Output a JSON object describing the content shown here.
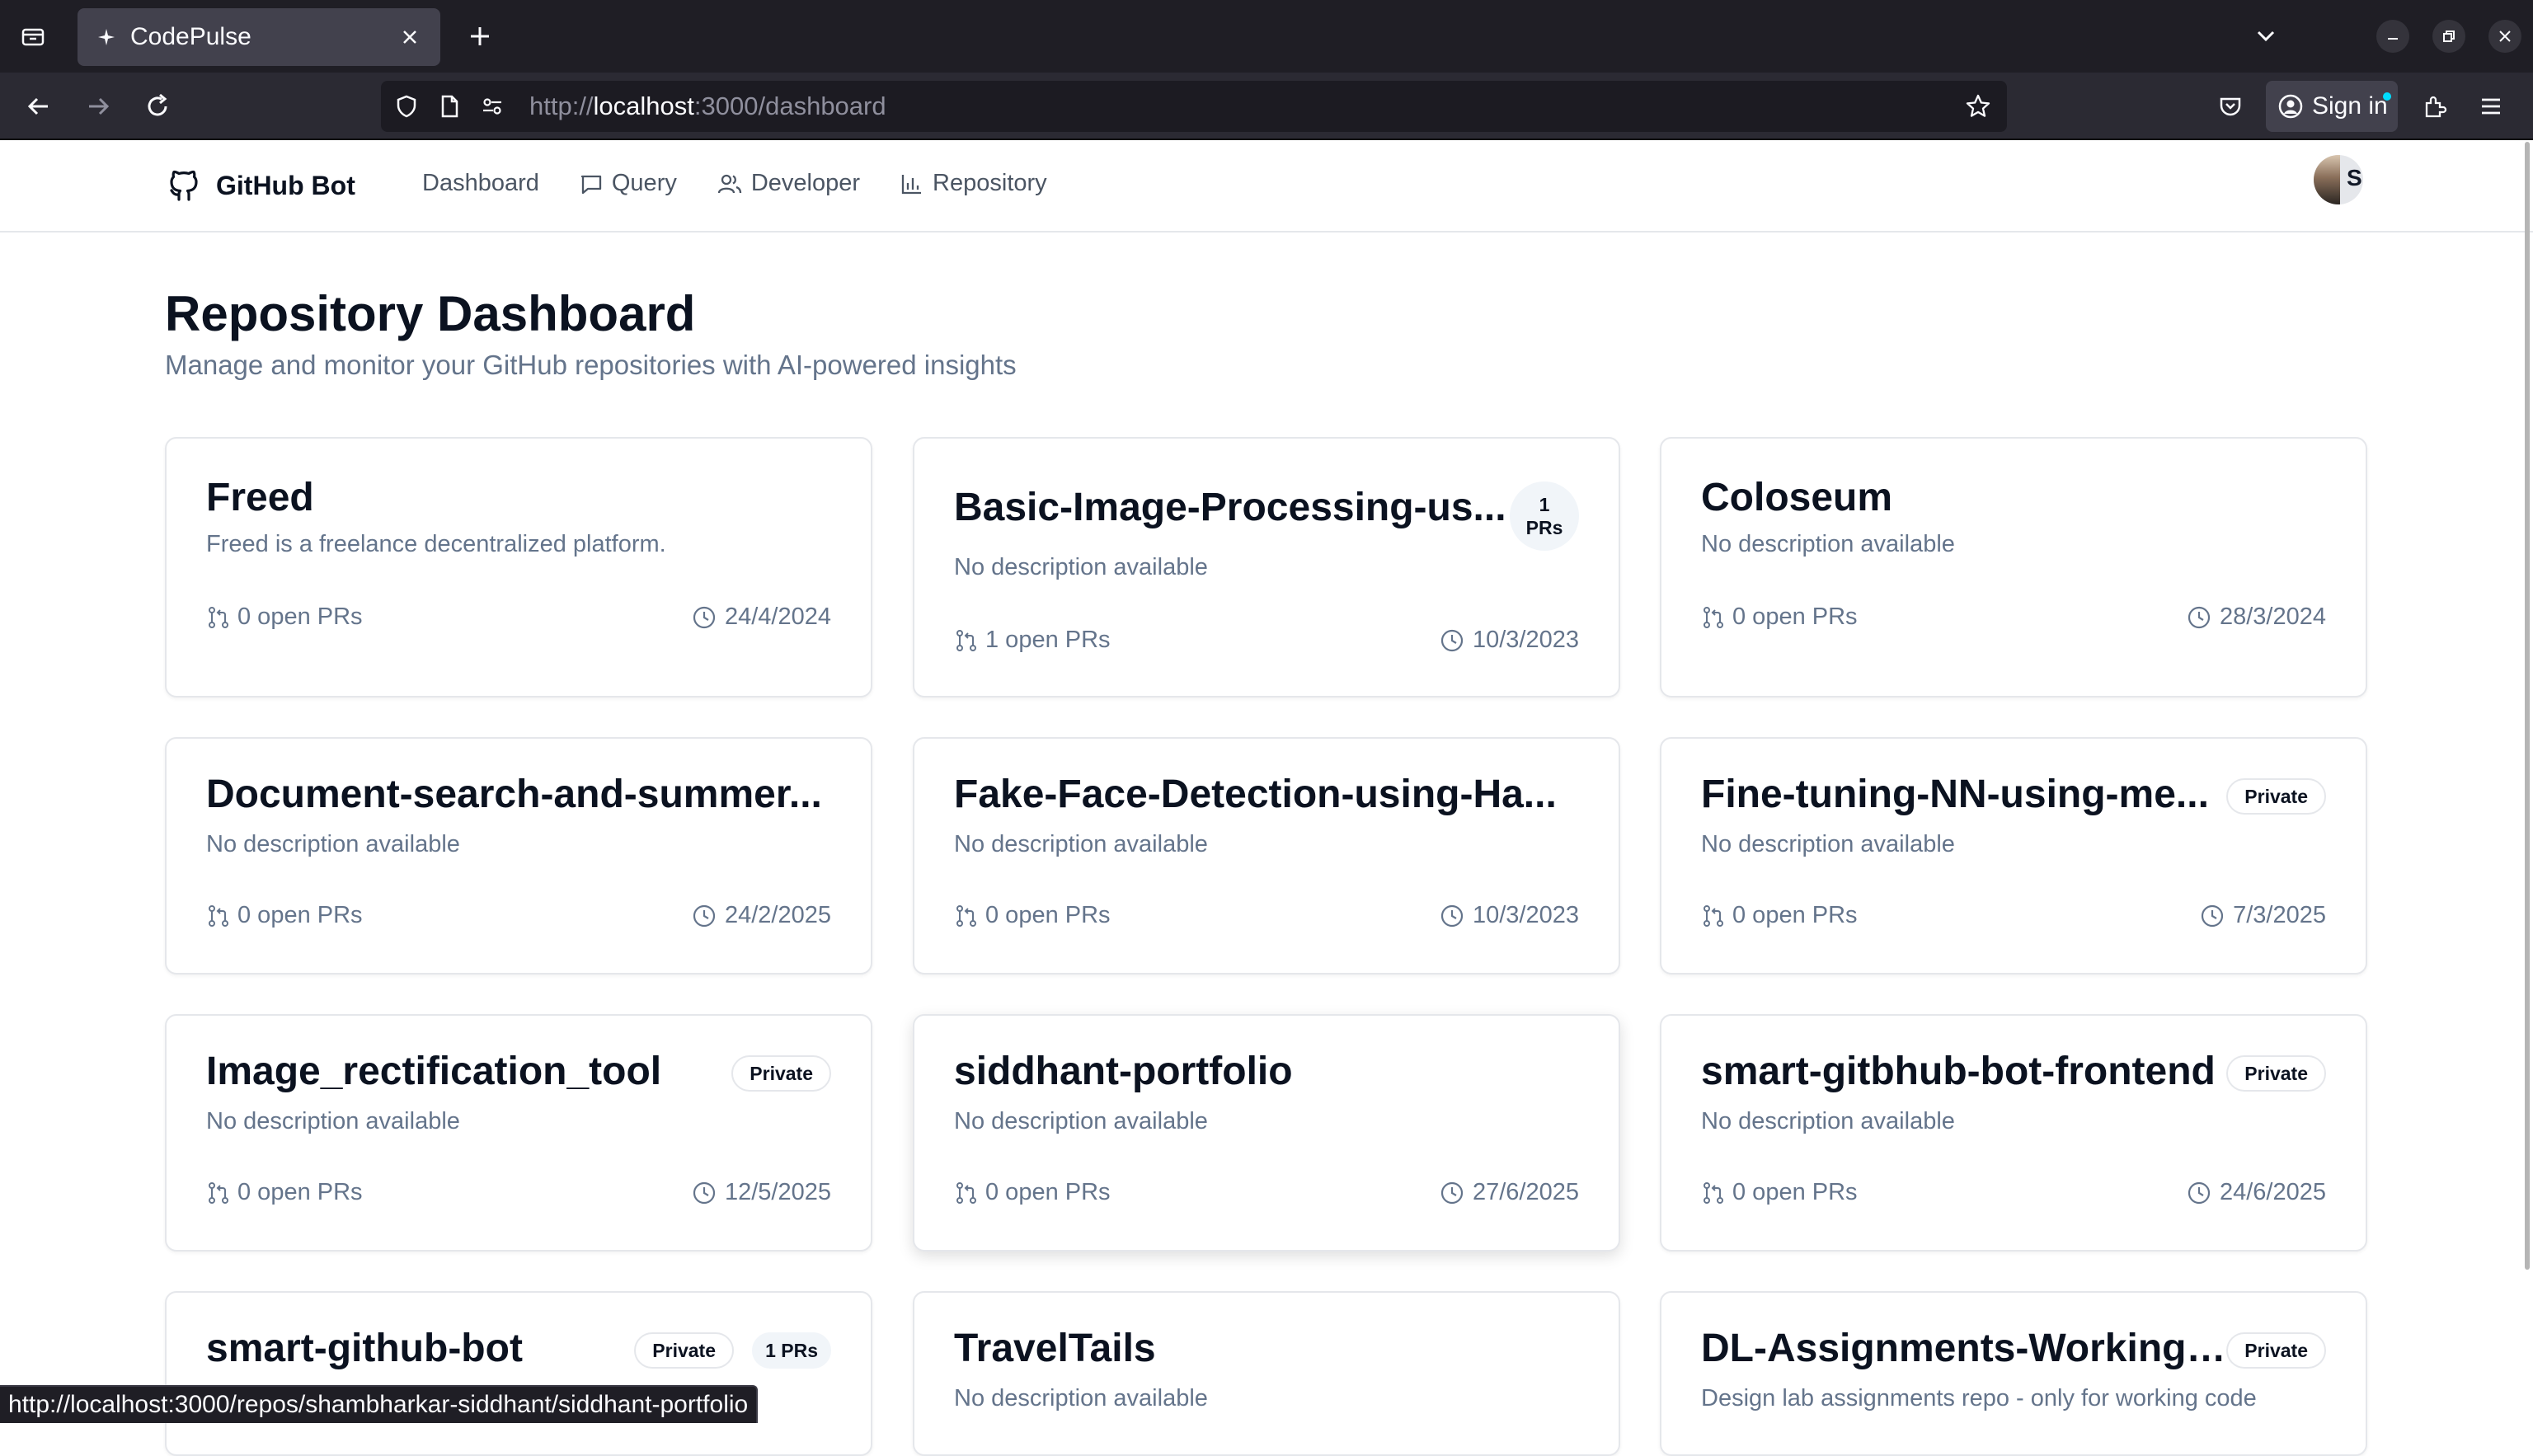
{
  "browser": {
    "tab_title": "CodePulse",
    "url_prefix": "http://",
    "url_host": "localhost",
    "url_rest": ":3000/dashboard",
    "sign_in_label": "Sign in",
    "status_url": "http://localhost:3000/repos/shambharkar-siddhant/siddhant-portfolio"
  },
  "app": {
    "brand": "GitHub Bot",
    "nav": {
      "dashboard": "Dashboard",
      "query": "Query",
      "developer": "Developer",
      "repository": "Repository"
    },
    "avatar_initial": "S"
  },
  "page": {
    "title": "Repository Dashboard",
    "subtitle": "Manage and monitor your GitHub repositories with AI-powered insights"
  },
  "repos": [
    {
      "name": "Freed",
      "description": "Freed is a freelance decentralized platform.",
      "prs": "0 open PRs",
      "date": "24/4/2024"
    },
    {
      "name": "Basic-Image-Processing-us...",
      "description": "No description available",
      "prs": "1 open PRs",
      "date": "10/3/2023",
      "pr_bubble_count": "1",
      "pr_bubble_unit": "PRs"
    },
    {
      "name": "Coloseum",
      "description": "No description available",
      "prs": "0 open PRs",
      "date": "28/3/2024"
    },
    {
      "name": "Document-search-and-summer...",
      "description": "No description available",
      "prs": "0 open PRs",
      "date": "24/2/2025"
    },
    {
      "name": "Fake-Face-Detection-using-Ha...",
      "description": "No description available",
      "prs": "0 open PRs",
      "date": "10/3/2023"
    },
    {
      "name": "Fine-tuning-NN-using-me...",
      "description": "No description available",
      "prs": "0 open PRs",
      "date": "7/3/2025",
      "badge": "Private"
    },
    {
      "name": "Image_rectification_tool",
      "description": "No description available",
      "prs": "0 open PRs",
      "date": "12/5/2025",
      "badge": "Private"
    },
    {
      "name": "siddhant-portfolio",
      "description": "No description available",
      "prs": "0 open PRs",
      "date": "27/6/2025"
    },
    {
      "name": "smart-gitbhub-bot-frontend",
      "description": "No description available",
      "prs": "0 open PRs",
      "date": "24/6/2025",
      "badge": "Private"
    },
    {
      "name": "smart-github-bot",
      "badge": "Private",
      "pr_badge": "1 PRs"
    },
    {
      "name": "TravelTails",
      "description": "No description available"
    },
    {
      "name": "DL-Assignments-Working-...",
      "description": "Design lab assignments repo - only for working code",
      "badge": "Private"
    }
  ]
}
